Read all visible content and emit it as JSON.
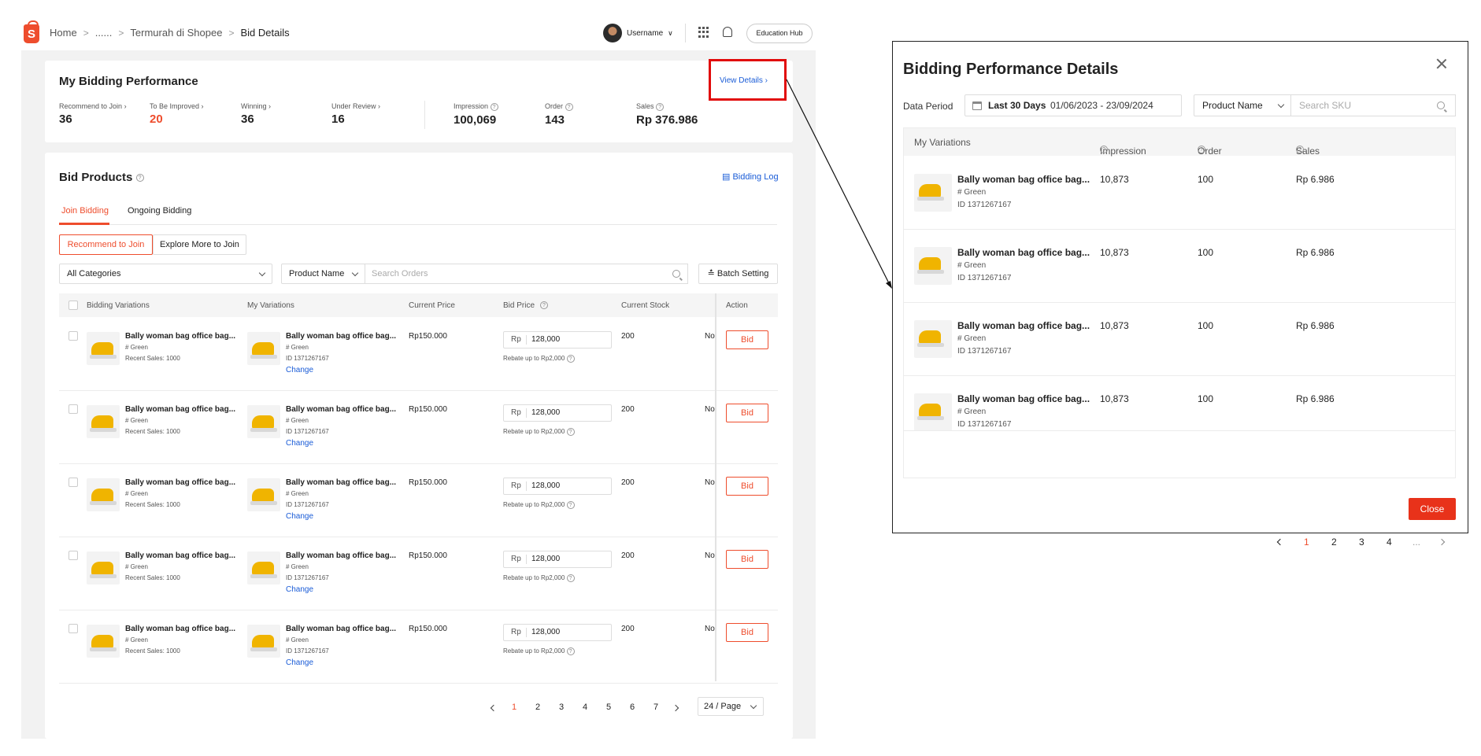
{
  "breadcrumb": {
    "home": "Home",
    "ellipsis": "......",
    "category": "Termurah di Shopee",
    "current": "Bid Details"
  },
  "header": {
    "username": "Username",
    "edu_hub": "Education Hub"
  },
  "performance": {
    "title": "My Bidding Performance",
    "view_details": "View Details",
    "metrics": [
      {
        "label": "Recommend to Join",
        "value": "36"
      },
      {
        "label": "To Be Improved",
        "value": "20"
      },
      {
        "label": "Winning",
        "value": "36"
      },
      {
        "label": "Under Review",
        "value": "16"
      },
      {
        "label": "Impression",
        "value": "100,069"
      },
      {
        "label": "Order",
        "value": "143"
      },
      {
        "label": "Sales",
        "value": "Rp 376.986"
      }
    ]
  },
  "bid_products": {
    "title": "Bid Products",
    "bidding_log": "Bidding Log",
    "tabs": [
      "Join Bidding",
      "Ongoing Bidding"
    ],
    "pills": [
      "Recommend to Join",
      "Explore More to Join"
    ],
    "category_select": "All Categories",
    "field_select": "Product Name",
    "search_placeholder": "Search Orders",
    "batch_setting": "Batch Setting",
    "columns": [
      "Bidding Variations",
      "My Variations",
      "Current Price",
      "Bid Price",
      "Current Stock",
      "Action"
    ],
    "row": {
      "bid_name": "Bally woman bag office bag...",
      "bid_variant": "# Green",
      "bid_sales": "Recent Sales: 1000",
      "my_name": "Bally woman bag office bag...",
      "my_variant": "# Green",
      "my_id": "ID 1371267167",
      "change": "Change",
      "current_price": "Rp150.000",
      "currency": "Rp",
      "bid_price": "128,000",
      "rebate": "Rebate up to Rp2,000",
      "stock": "200",
      "truncated": "No",
      "bid_btn": "Bid"
    },
    "pages": [
      "1",
      "2",
      "3",
      "4",
      "5",
      "6",
      "7"
    ],
    "per_page": "24 / Page"
  },
  "modal": {
    "title": "Bidding Performance Details",
    "data_period_label": "Data Period",
    "period_name": "Last 30 Days",
    "period_range": "01/06/2023 - 23/09/2024",
    "field_select": "Product Name",
    "search_placeholder": "Search SKU",
    "columns": [
      "My Variations",
      "Impression",
      "Order",
      "Sales"
    ],
    "row": {
      "name": "Bally woman bag office bag...",
      "variant": "# Green",
      "id": "ID 1371267167",
      "impression": "10,873",
      "order": "100",
      "sales": "Rp 6.986"
    },
    "pages": [
      "1",
      "2",
      "3",
      "4",
      "..."
    ],
    "close_btn": "Close"
  },
  "colors": {
    "accent": "#ee4d2d",
    "link": "#1a5cd7",
    "highlight": "#e10a0a"
  }
}
